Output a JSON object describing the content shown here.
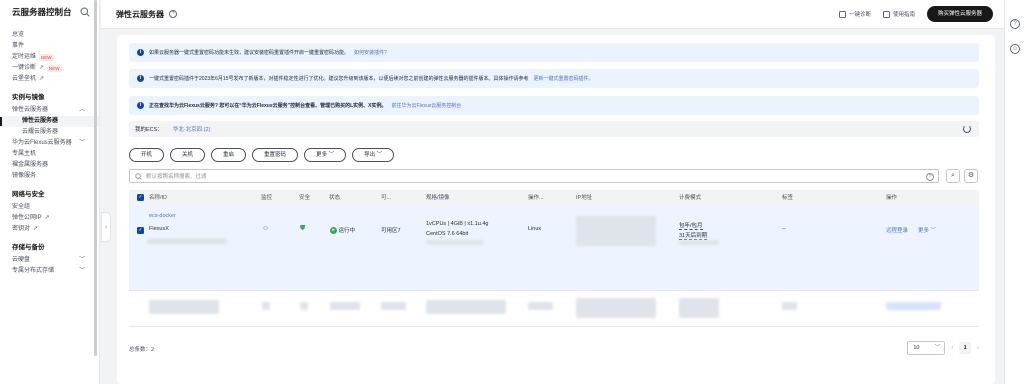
{
  "sidebar": {
    "title": "云服务器控制台",
    "items": [
      {
        "label": "总览"
      },
      {
        "label": "事件"
      },
      {
        "label": "定时运维",
        "badge": "NEW"
      },
      {
        "label": "一键诊断",
        "badge": "NEW"
      },
      {
        "label": "云堡垒机"
      }
    ],
    "section1": "实例与镜像",
    "instances": [
      {
        "label": "弹性云服务器"
      },
      {
        "label": "弹性云服务器"
      },
      {
        "label": "云耀云服务器"
      },
      {
        "label": "华为云Flexus云服务器"
      },
      {
        "label": "专属主机"
      },
      {
        "label": "裸金属服务器"
      },
      {
        "label": "镜像服务"
      }
    ],
    "section2": "网络与安全",
    "network": [
      {
        "label": "安全组"
      },
      {
        "label": "弹性公网IP"
      },
      {
        "label": "密钥对"
      }
    ],
    "section3": "存储与备份",
    "storage": [
      {
        "label": "云硬盘"
      },
      {
        "label": "专属分布式存储"
      }
    ]
  },
  "header": {
    "title": "弹性云服务器",
    "diagnose": "一键诊断",
    "guide": "使用指南",
    "buy": "购买弹性云服务器"
  },
  "notices": [
    {
      "text": "如果云服务器一键式重置密码功能未生效，建议安装密码重置插件开启一键重置密码功能。",
      "link": "如何安装插件?"
    },
    {
      "text": "一键式重置密码插件于2023年6月15号发布了新版本，对插件稳定性进行了优化。建议您升级到该版本，以便后续对您之前创建的弹性云服务器的插件版本。具体操作请参考",
      "link": "更新一键式重置密码插件。"
    },
    {
      "text": "正在查找华为云Flexus云服务? 您可以在“华为云Flexus云服务”控制台查看、管理已购买的L实例、X实例。",
      "link": "前往华为云Flexus云服务控制台"
    }
  ],
  "myecs": {
    "label": "我的ECS：",
    "region": "华北-北京四 (2)"
  },
  "actions": {
    "start": "开机",
    "stop": "关机",
    "restart": "重启",
    "reset_pwd": "重置密码",
    "more": "更多",
    "export": "导出"
  },
  "search": {
    "placeholder": "默认按照名称搜索、过滤"
  },
  "table": {
    "headers": {
      "name": "名称/ID",
      "monitor": "监控",
      "security": "安全",
      "status": "状态",
      "az": "可...",
      "spec": "规格/镜像",
      "os": "操作...",
      "ip": "IP地址",
      "billing": "计费模式",
      "tag": "标签",
      "ops": "操作"
    },
    "row1": {
      "name": "ecs-docker",
      "type": "FlexusX",
      "status": "运行中",
      "az": "可用区7",
      "spec_line1": "1vCPUs | 4GiB | x1.1u.4g",
      "spec_line2": "CentOS 7.6 64bit",
      "os": "Linux",
      "billing_line1": "包年/包月",
      "billing_line2": "31天后到期",
      "tag": "--",
      "remote_login": "远程登录",
      "more": "更多"
    }
  },
  "footer": {
    "total": "总条数：2",
    "page_size": "10",
    "current_page": "1"
  }
}
